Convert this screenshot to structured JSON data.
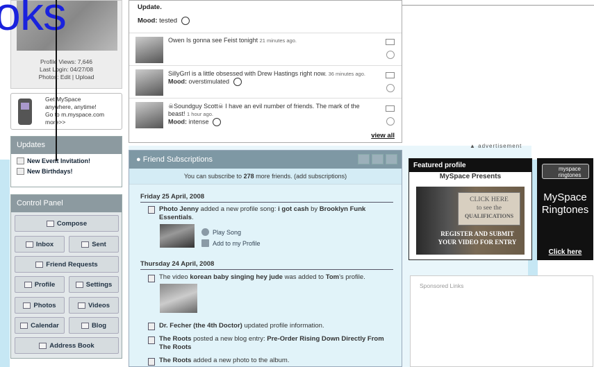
{
  "watermark": {
    "text": "oks"
  },
  "profile": {
    "views": "Profile Views: 7,646",
    "last_login": "Last Login: 04/27/08",
    "photos_label": "Photos:",
    "edit": "Edit",
    "sep": "|",
    "upload": "Upload"
  },
  "mobile": {
    "line1": "Get MySpace",
    "line2": "anywhere, anytime!",
    "line3": "Go to m.myspace.com",
    "more": "more>>"
  },
  "updates": {
    "title": "Updates",
    "items": [
      "New Event Invitation!",
      "New Birthdays!"
    ]
  },
  "control_panel": {
    "title": "Control Panel",
    "compose": "Compose",
    "inbox": "Inbox",
    "sent": "Sent",
    "friend_requests": "Friend Requests",
    "profile": "Profile",
    "settings": "Settings",
    "photos": "Photos",
    "videos": "Videos",
    "calendar": "Calendar",
    "blog": "Blog",
    "address_book": "Address Book"
  },
  "status": {
    "top_label": "Update.",
    "top_mood_label": "Mood:",
    "top_mood": "tested",
    "rows": [
      {
        "text": "Owen Is gonna see Feist tonight",
        "time": "21 minutes ago.",
        "mood_label": "",
        "mood": ""
      },
      {
        "text": "SillyGrrl is a little obsessed with Drew Hastings right now.",
        "time": "36 minutes ago.",
        "mood_label": "Mood:",
        "mood": "overstimulated"
      },
      {
        "text": "☠Soundguy Scott☠ I have an evil number of friends. The mark of the beast!",
        "time": "1 hour ago.",
        "mood_label": "Mood:",
        "mood": "intense"
      }
    ],
    "view_all": "view all"
  },
  "friend_subs": {
    "title": "Friend Subscriptions",
    "subscribe_pre": "You can subscribe to",
    "subscribe_count": "278",
    "subscribe_post": "more friends. (add subscriptions)",
    "date1": "Friday 25 April, 2008",
    "item1_pre": "Photo Jenny",
    "item1_mid": "added a new profile song:",
    "item1_song": "i got cash",
    "item1_by": "by",
    "item1_artist": "Brooklyn Funk Essentials",
    "item1_end": ".",
    "play_song": "Play Song",
    "add_profile": "Add to my Profile",
    "date2": "Thursday 24 April, 2008",
    "item2_pre": "The video",
    "item2_title": "korean baby singing hey jude",
    "item2_mid": "was added to",
    "item2_owner": "Tom",
    "item2_end": "'s profile.",
    "item3_name": "Dr. Fecher (the 4th Doctor)",
    "item3_text": "updated profile information.",
    "item4_name": "The Roots",
    "item4_text": "posted a new blog entry:",
    "item4_title": "Pre-Order Rising Down Directly From The Roots",
    "item5_name": "The Roots",
    "item5_text": "added a new photo to the album."
  },
  "ads": {
    "label": "▲ advertisement",
    "featured_title": "Featured profile",
    "featured_sub": "MySpace Presents",
    "cta1": "CLICK HERE",
    "cta2": "to see the",
    "cta3": "QUALIFICATIONS",
    "reg1": "REGISTER AND SUBMIT",
    "reg2": "YOUR VIDEO FOR ENTRY",
    "ring_logo1": "myspace",
    "ring_logo2": "ringtones",
    "ring_title1": "MySpace",
    "ring_title2": "Ringtones",
    "ring_click": "Click here",
    "sponsored": "Sponsored Links"
  }
}
